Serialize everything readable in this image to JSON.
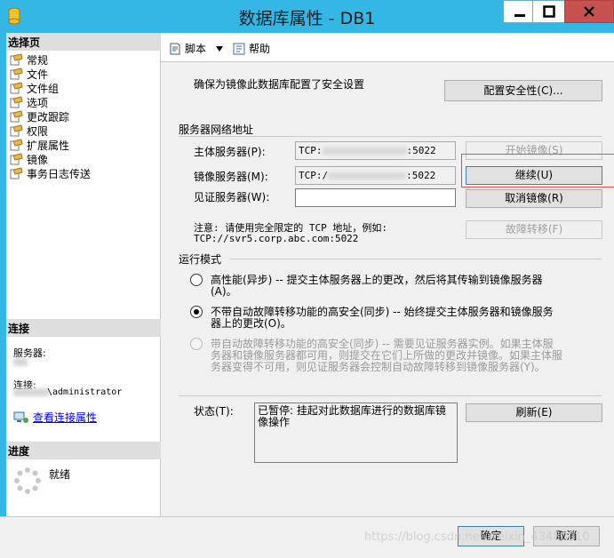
{
  "window": {
    "title": "数据库属性 - DB1"
  },
  "sidebar": {
    "select_page_header": "选择页",
    "items": [
      {
        "label": "常规"
      },
      {
        "label": "文件"
      },
      {
        "label": "文件组"
      },
      {
        "label": "选项"
      },
      {
        "label": "更改跟踪"
      },
      {
        "label": "权限"
      },
      {
        "label": "扩展属性"
      },
      {
        "label": "镜像"
      },
      {
        "label": "事务日志传送"
      }
    ],
    "connection_header": "连接",
    "server_label": "服务器:",
    "conn_label": "连接:",
    "conn_user": "\\administrator",
    "view_conn_props": "查看连接属性",
    "progress_header": "进度",
    "progress_status": "就绪"
  },
  "toolbar": {
    "script_label": "脚本",
    "help_label": "帮助"
  },
  "main": {
    "security_hint": "确保为镜像此数据库配置了安全设置",
    "config_security_btn": "配置安全性(C)...",
    "server_network_title": "服务器网络地址",
    "principal_label": "主体服务器(P):",
    "principal_prefix": "TCP:",
    "principal_suffix": ":5022",
    "mirror_label": "镜像服务器(M):",
    "mirror_prefix": "TCP:/",
    "mirror_suffix": ":5022",
    "witness_label": "见证服务器(W):",
    "witness_value": "",
    "start_mirroring_btn": "开始镜像(S)",
    "resume_btn": "继续(U)",
    "remove_mirroring_btn": "取消镜像(R)",
    "failover_btn": "故障转移(F)",
    "note_line1": "注意: 请使用完全限定的 TCP 地址，例如:",
    "note_line2": "TCP://svr5.corp.abc.com:5022",
    "op_mode_title": "运行模式",
    "mode1_line1": "高性能(异步) -- 提交主体服务器上的更改，然后将其传输到镜像服务器",
    "mode1_line2": "(A)。",
    "mode2_line1": "不带自动故障转移功能的高安全(同步) -- 始终提交主体服务器和镜像服务",
    "mode2_line2": "器上的更改(O)。",
    "mode3_line1": "带自动故障转移功能的高安全(同步) -- 需要见证服务器实例。如果主体服",
    "mode3_line2": "务器和镜像服务器都可用，则提交在它们上所做的更改并镜像。如果主体服",
    "mode3_line3": "务器变得不可用，则见证服务器会控制自动故障转移到镜像服务器(Y)。",
    "status_label": "状态(T):",
    "status_line1": "已暂停: 挂起对此数据库进行的数据库镜",
    "status_line2": "像操作",
    "refresh_btn": "刷新(E)"
  },
  "footer": {
    "ok_btn": "确定",
    "cancel_btn": "取消"
  },
  "watermark": "https://blog.csdn.net/weixin_43480010",
  "colors": {
    "titlebar": "#35b7e6",
    "close": "#c75050",
    "highlight_box": "#e05050",
    "link": "#0000ee"
  }
}
